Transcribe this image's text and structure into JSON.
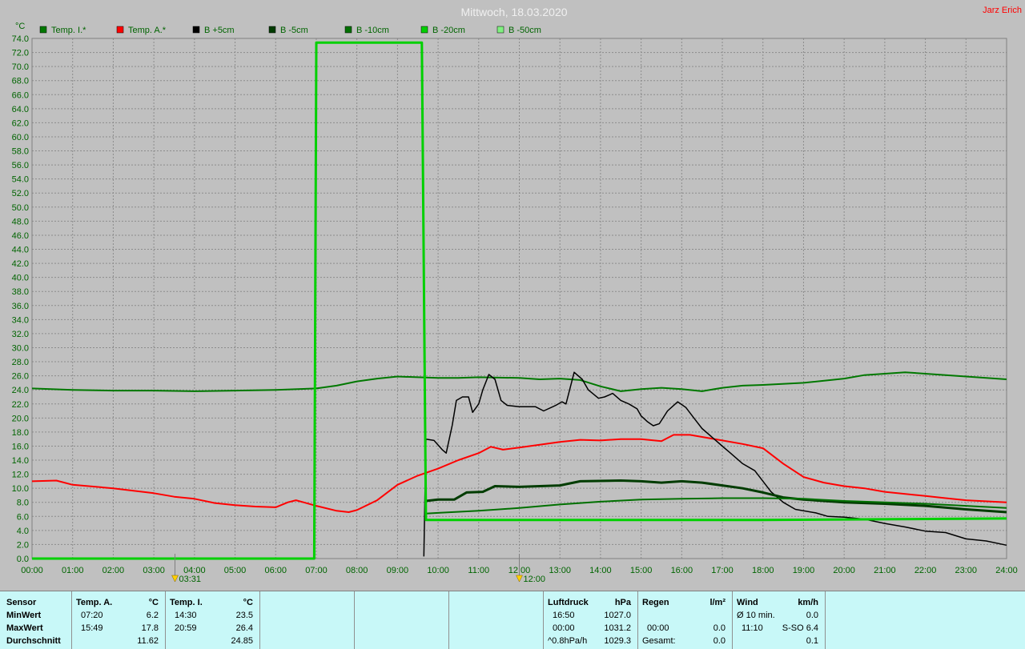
{
  "title": "Mittwoch, 18.03.2020",
  "author": "Jarz Erich",
  "colors": {
    "background": "#c0c0c0",
    "grid": "#8c8c8c",
    "axis_text": "#006400",
    "stats_bg": "#c8f8f8"
  },
  "chart_data": {
    "type": "line",
    "ylabel": "°C",
    "ylim": [
      0,
      74
    ],
    "y_ticks": [
      "0.0",
      "2.0",
      "4.0",
      "6.0",
      "8.0",
      "10.0",
      "12.0",
      "14.0",
      "16.0",
      "18.0",
      "20.0",
      "22.0",
      "24.0",
      "26.0",
      "28.0",
      "30.0",
      "32.0",
      "34.0",
      "36.0",
      "38.0",
      "40.0",
      "42.0",
      "44.0",
      "46.0",
      "48.0",
      "50.0",
      "52.0",
      "54.0",
      "56.0",
      "58.0",
      "60.0",
      "62.0",
      "64.0",
      "66.0",
      "68.0",
      "70.0",
      "72.0",
      "74.0"
    ],
    "xlim": [
      0,
      24
    ],
    "x_ticks": [
      "00:00",
      "01:00",
      "02:00",
      "03:00",
      "04:00",
      "05:00",
      "06:00",
      "07:00",
      "08:00",
      "09:00",
      "10:00",
      "11:00",
      "12:00",
      "13:00",
      "14:00",
      "15:00",
      "16:00",
      "17:00",
      "18:00",
      "19:00",
      "20:00",
      "21:00",
      "22:00",
      "23:00",
      "24:00"
    ],
    "grid": true,
    "legend_position": "top-left",
    "markers": [
      {
        "label": "03:31",
        "hour": 3.52
      },
      {
        "label": "12:00",
        "hour": 12.0
      }
    ],
    "series": [
      {
        "name": "Temp. I.*",
        "color": "#007800",
        "points": [
          [
            0,
            24.2
          ],
          [
            1,
            24.0
          ],
          [
            2,
            23.9
          ],
          [
            3,
            23.9
          ],
          [
            4,
            23.8
          ],
          [
            5,
            23.9
          ],
          [
            6,
            24.0
          ],
          [
            7,
            24.2
          ],
          [
            7.5,
            24.6
          ],
          [
            8,
            25.2
          ],
          [
            8.5,
            25.6
          ],
          [
            9,
            25.9
          ],
          [
            9.5,
            25.8
          ],
          [
            10,
            25.7
          ],
          [
            10.5,
            25.7
          ],
          [
            11,
            25.8
          ],
          [
            12,
            25.7
          ],
          [
            12.5,
            25.5
          ],
          [
            13,
            25.6
          ],
          [
            13.5,
            25.4
          ],
          [
            14,
            24.5
          ],
          [
            14.5,
            23.8
          ],
          [
            15,
            24.1
          ],
          [
            15.5,
            24.3
          ],
          [
            16,
            24.1
          ],
          [
            16.5,
            23.8
          ],
          [
            17,
            24.3
          ],
          [
            17.5,
            24.6
          ],
          [
            18,
            24.7
          ],
          [
            19,
            25.0
          ],
          [
            20,
            25.6
          ],
          [
            20.5,
            26.1
          ],
          [
            21,
            26.3
          ],
          [
            21.5,
            26.5
          ],
          [
            22,
            26.3
          ],
          [
            23,
            25.9
          ],
          [
            24,
            25.5
          ]
        ]
      },
      {
        "name": "Temp. A.*",
        "color": "#ff0000",
        "points": [
          [
            0,
            11.0
          ],
          [
            0.6,
            11.1
          ],
          [
            1,
            10.5
          ],
          [
            2,
            10.0
          ],
          [
            3,
            9.3
          ],
          [
            3.5,
            8.8
          ],
          [
            4,
            8.5
          ],
          [
            4.5,
            7.9
          ],
          [
            5,
            7.6
          ],
          [
            5.5,
            7.4
          ],
          [
            6,
            7.3
          ],
          [
            6.3,
            8.0
          ],
          [
            6.5,
            8.3
          ],
          [
            7,
            7.5
          ],
          [
            7.5,
            6.8
          ],
          [
            7.8,
            6.6
          ],
          [
            8,
            6.9
          ],
          [
            8.5,
            8.3
          ],
          [
            9,
            10.5
          ],
          [
            9.5,
            11.8
          ],
          [
            10,
            12.8
          ],
          [
            10.5,
            14.0
          ],
          [
            11,
            15.0
          ],
          [
            11.3,
            15.9
          ],
          [
            11.6,
            15.5
          ],
          [
            12,
            15.8
          ],
          [
            12.5,
            16.2
          ],
          [
            13,
            16.6
          ],
          [
            13.5,
            16.9
          ],
          [
            14,
            16.8
          ],
          [
            14.5,
            17.0
          ],
          [
            15,
            17.0
          ],
          [
            15.5,
            16.7
          ],
          [
            15.8,
            17.6
          ],
          [
            16.2,
            17.6
          ],
          [
            16.5,
            17.3
          ],
          [
            17,
            16.8
          ],
          [
            17.5,
            16.3
          ],
          [
            18,
            15.7
          ],
          [
            18.5,
            13.5
          ],
          [
            19,
            11.6
          ],
          [
            19.5,
            10.8
          ],
          [
            20,
            10.3
          ],
          [
            20.5,
            10.0
          ],
          [
            21,
            9.5
          ],
          [
            22,
            8.9
          ],
          [
            22.5,
            8.6
          ],
          [
            23,
            8.3
          ],
          [
            24,
            8.0
          ]
        ]
      },
      {
        "name": "B +5cm",
        "color": "#000000",
        "points": [
          [
            9.65,
            0.3
          ],
          [
            9.7,
            17.0
          ],
          [
            9.9,
            16.8
          ],
          [
            10.1,
            15.5
          ],
          [
            10.2,
            15.0
          ],
          [
            10.35,
            19.0
          ],
          [
            10.45,
            22.5
          ],
          [
            10.6,
            23.0
          ],
          [
            10.75,
            23.0
          ],
          [
            10.85,
            20.8
          ],
          [
            11.0,
            22.0
          ],
          [
            11.1,
            24.0
          ],
          [
            11.25,
            26.2
          ],
          [
            11.4,
            25.5
          ],
          [
            11.55,
            22.5
          ],
          [
            11.7,
            21.8
          ],
          [
            12.0,
            21.6
          ],
          [
            12.4,
            21.6
          ],
          [
            12.6,
            21.0
          ],
          [
            12.9,
            21.8
          ],
          [
            13.05,
            22.3
          ],
          [
            13.15,
            22.0
          ],
          [
            13.35,
            26.5
          ],
          [
            13.55,
            25.5
          ],
          [
            13.7,
            24.0
          ],
          [
            13.95,
            22.8
          ],
          [
            14.1,
            23.0
          ],
          [
            14.3,
            23.5
          ],
          [
            14.5,
            22.5
          ],
          [
            14.7,
            22.0
          ],
          [
            14.9,
            21.3
          ],
          [
            15.0,
            20.3
          ],
          [
            15.15,
            19.5
          ],
          [
            15.3,
            18.9
          ],
          [
            15.45,
            19.2
          ],
          [
            15.65,
            21.0
          ],
          [
            15.9,
            22.3
          ],
          [
            16.1,
            21.5
          ],
          [
            16.3,
            20.0
          ],
          [
            16.5,
            18.5
          ],
          [
            16.8,
            17.0
          ],
          [
            17.0,
            16.0
          ],
          [
            17.2,
            15.0
          ],
          [
            17.5,
            13.5
          ],
          [
            17.8,
            12.5
          ],
          [
            18.0,
            11.0
          ],
          [
            18.2,
            9.5
          ],
          [
            18.5,
            8.0
          ],
          [
            18.8,
            7.0
          ],
          [
            19.3,
            6.5
          ],
          [
            19.6,
            6.0
          ],
          [
            20.0,
            5.9
          ],
          [
            20.5,
            5.6
          ],
          [
            21.0,
            5.0
          ],
          [
            21.5,
            4.5
          ],
          [
            22.0,
            3.9
          ],
          [
            22.5,
            3.7
          ],
          [
            23.0,
            2.8
          ],
          [
            23.5,
            2.5
          ],
          [
            24.0,
            1.9
          ]
        ]
      },
      {
        "name": "B -5cm",
        "color": "#003c00",
        "points": [
          [
            9.7,
            8.2
          ],
          [
            10,
            8.4
          ],
          [
            10.4,
            8.4
          ],
          [
            10.7,
            9.4
          ],
          [
            11.1,
            9.5
          ],
          [
            11.4,
            10.3
          ],
          [
            12,
            10.2
          ],
          [
            13,
            10.4
          ],
          [
            13.5,
            11.0
          ],
          [
            14.5,
            11.1
          ],
          [
            15,
            11.0
          ],
          [
            15.5,
            10.8
          ],
          [
            16,
            11.0
          ],
          [
            16.5,
            10.8
          ],
          [
            17,
            10.4
          ],
          [
            17.5,
            10.0
          ],
          [
            18,
            9.4
          ],
          [
            18.5,
            8.7
          ],
          [
            19,
            8.4
          ],
          [
            20,
            8.0
          ],
          [
            21,
            7.8
          ],
          [
            22,
            7.5
          ],
          [
            23,
            7.0
          ],
          [
            24,
            6.6
          ]
        ]
      },
      {
        "name": "B -10cm",
        "color": "#007000",
        "points": [
          [
            9.7,
            6.4
          ],
          [
            10,
            6.5
          ],
          [
            11,
            6.8
          ],
          [
            12,
            7.2
          ],
          [
            13,
            7.7
          ],
          [
            14,
            8.1
          ],
          [
            15,
            8.4
          ],
          [
            16,
            8.5
          ],
          [
            17,
            8.6
          ],
          [
            18,
            8.6
          ],
          [
            19,
            8.5
          ],
          [
            20,
            8.2
          ],
          [
            21,
            8.0
          ],
          [
            22,
            7.8
          ],
          [
            23,
            7.5
          ],
          [
            24,
            7.2
          ]
        ]
      },
      {
        "name": "B -20cm",
        "color": "#00d000",
        "points": [
          [
            0,
            0
          ],
          [
            6.95,
            0
          ],
          [
            7.0,
            73.4
          ],
          [
            9.6,
            73.4
          ],
          [
            9.7,
            5.5
          ],
          [
            18,
            5.5
          ],
          [
            24,
            5.7
          ]
        ]
      },
      {
        "name": "B -50cm",
        "color": "#80f080",
        "points": []
      }
    ]
  },
  "stats": {
    "sensor_header": "Sensor",
    "row_labels": [
      "MinWert",
      "MaxWert",
      "Durchschnitt"
    ],
    "temp_a": {
      "title": "Temp. A.",
      "unit": "°C",
      "rows": [
        {
          "time": "07:20",
          "value": "6.2"
        },
        {
          "time": "15:49",
          "value": "17.8"
        },
        {
          "time": "",
          "value": "11.62"
        }
      ]
    },
    "temp_i": {
      "title": "Temp. I.",
      "unit": "°C",
      "rows": [
        {
          "time": "14:30",
          "value": "23.5"
        },
        {
          "time": "20:59",
          "value": "26.4"
        },
        {
          "time": "",
          "value": "24.85"
        }
      ]
    },
    "luftdruck": {
      "title": "Luftdruck",
      "unit": "hPa",
      "rows": [
        {
          "time": "16:50",
          "value": "1027.0"
        },
        {
          "time": "00:00",
          "value": "1031.2"
        },
        {
          "time": "^0.8hPa/h",
          "value": "1029.3"
        }
      ]
    },
    "regen": {
      "title": "Regen",
      "unit": "l/m²",
      "rows": [
        {
          "time": "",
          "value": ""
        },
        {
          "time": "00:00",
          "value": "0.0"
        },
        {
          "time": "Gesamt:",
          "value": "0.0"
        }
      ]
    },
    "wind": {
      "title": "Wind",
      "unit": "km/h",
      "rows": [
        {
          "time": "Ø 10 min.",
          "value": "0.0"
        },
        {
          "time": "11:10",
          "value": "S-SO 6.4"
        },
        {
          "time": "",
          "value": "0.1"
        }
      ]
    }
  }
}
